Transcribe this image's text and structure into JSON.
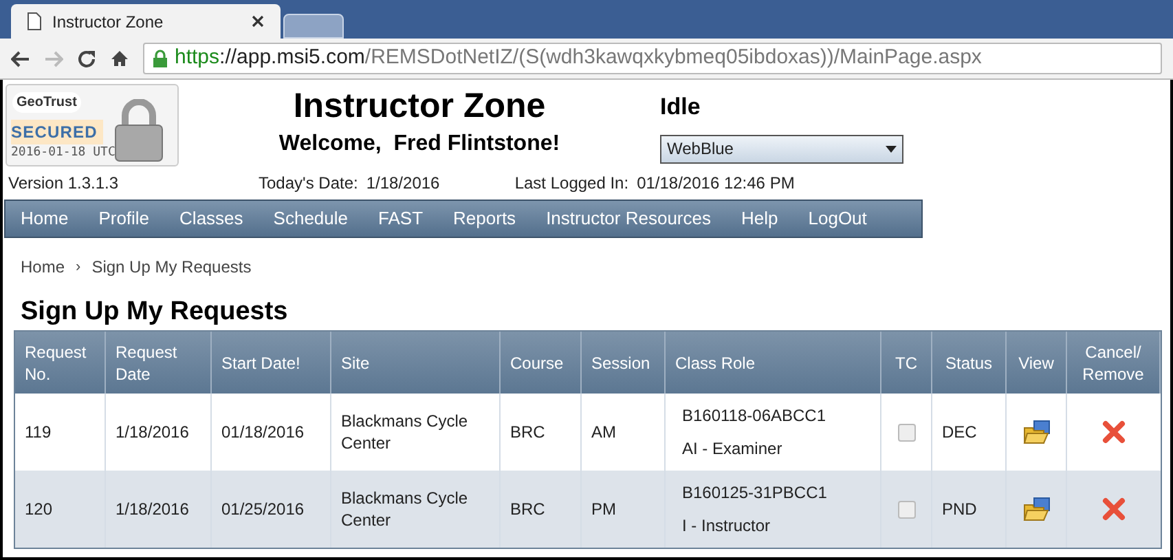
{
  "browser": {
    "tab_title": "Instructor Zone",
    "url": {
      "scheme": "https",
      "host": "://app.msi5.com",
      "path": "/REMSDotNetIZ/(S(wdh3kawqxkybmeq05ibdoxas))/MainPage.aspx"
    }
  },
  "header": {
    "seal": {
      "brand": "GeoTrust",
      "label": "SECURED",
      "date": "2016-01-18 UTC"
    },
    "title": "Instructor Zone",
    "welcome": "Welcome,  Fred Flintstone!",
    "status": "Idle",
    "theme_select": {
      "value": "WebBlue"
    },
    "version": "Version 1.3.1.3",
    "today_label": "Today's Date:",
    "today": "1/18/2016",
    "last_login_label": "Last Logged In:",
    "last_login": "01/18/2016 12:46 PM"
  },
  "nav": [
    "Home",
    "Profile",
    "Classes",
    "Schedule",
    "FAST",
    "Reports",
    "Instructor Resources",
    "Help",
    "LogOut"
  ],
  "breadcrumb": [
    "Home",
    "Sign Up My Requests"
  ],
  "breadcrumb_separator": "›",
  "page_title": "Sign Up My Requests",
  "table": {
    "columns": [
      "Request No.",
      "Request Date",
      "Start Date!",
      "Site",
      "Course",
      "Session",
      "Class Role",
      "TC",
      "Status",
      "View",
      "Cancel/ Remove"
    ],
    "rows": [
      {
        "request_no": "119",
        "request_date": "1/18/2016",
        "start_date": "01/18/2016",
        "site": "Blackmans Cycle Center",
        "course": "BRC",
        "session": "AM",
        "class_code": "B160118-06ABCC1",
        "class_role": "AI - Examiner",
        "tc": {
          "checked": false
        },
        "status": "DEC"
      },
      {
        "request_no": "120",
        "request_date": "1/18/2016",
        "start_date": "01/25/2016",
        "site": "Blackmans Cycle Center",
        "course": "BRC",
        "session": "PM",
        "class_code": "B160125-31PBCC1",
        "class_role": "I - Instructor",
        "tc": {
          "checked": false
        },
        "status": "PND"
      }
    ]
  }
}
